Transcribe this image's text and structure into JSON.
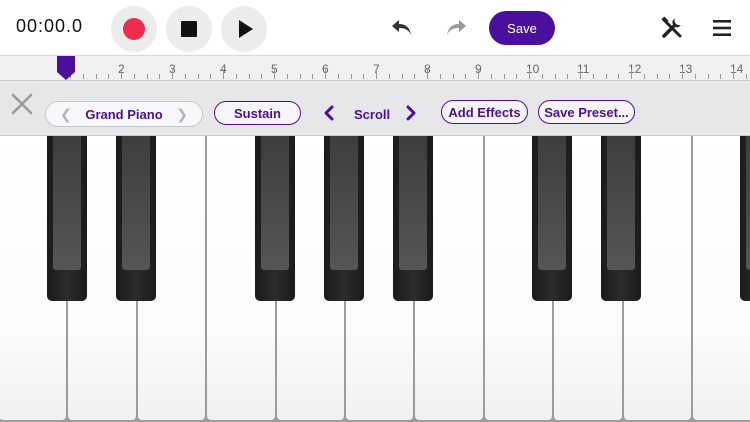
{
  "transport": {
    "time": "00:00.0",
    "record_icon": "record-icon",
    "stop_icon": "stop-icon",
    "play_icon": "play-icon"
  },
  "edit": {
    "undo_icon": "undo-icon",
    "redo_icon": "redo-icon"
  },
  "save_label": "Save",
  "tools_icon": "tools-icon",
  "menu_icon": "hamburger-menu-icon",
  "ruler": {
    "numbers": [
      "2",
      "3",
      "4",
      "5",
      "6",
      "7",
      "8",
      "9",
      "10",
      "11",
      "12",
      "13",
      "14"
    ]
  },
  "instrument": {
    "name": "Grand Piano"
  },
  "controls": {
    "sustain": "Sustain",
    "scroll": "Scroll",
    "add_effects": "Add Effects",
    "save_preset": "Save Preset..."
  },
  "colors": {
    "accent": "#4b0f9e",
    "record": "#ec2d4f"
  }
}
